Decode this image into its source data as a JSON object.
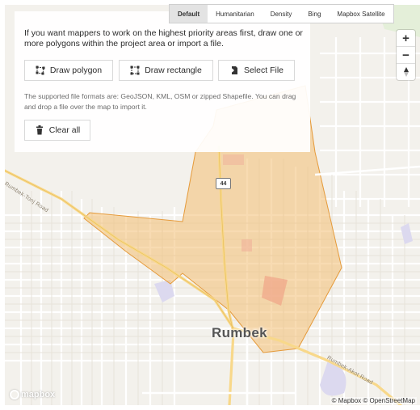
{
  "instructions": {
    "intro": "If you want mappers to work on the highest priority areas first, draw one or more polygons within the project area or import a file.",
    "formats": "The supported file formats are: GeoJSON, KML, OSM or zipped Shapefile. You can drag and drop a file over the map to import it."
  },
  "buttons": {
    "draw_polygon": "Draw polygon",
    "draw_rectangle": "Draw rectangle",
    "select_file": "Select File",
    "clear_all": "Clear all"
  },
  "layers": [
    "Default",
    "Humanitarian",
    "Density",
    "Bing",
    "Mapbox Satellite"
  ],
  "active_layer": "Default",
  "zoom": {
    "in": "+",
    "out": "−"
  },
  "map": {
    "city": "Rumbek",
    "road_west": "Rumbek-Tonj Road",
    "road_east": "Rumbek-Akot Road",
    "highway": "44",
    "attribution": "© Mapbox © OpenStreetMap",
    "logo": "mapbox"
  },
  "colors": {
    "priority_area_fill": "#f2bd73",
    "priority_area_stroke": "#e59a3a"
  }
}
